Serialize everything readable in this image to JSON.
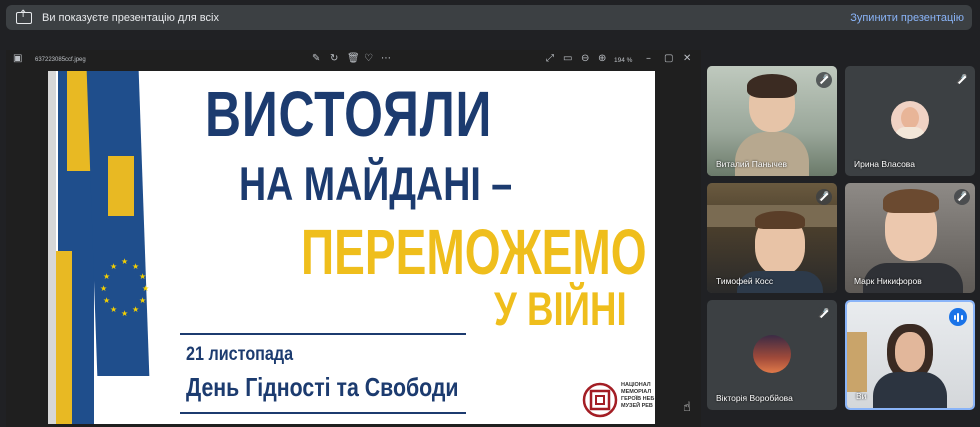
{
  "banner": {
    "text": "Ви показуєте презентацію для всіх",
    "stop_label": "Зупинити презентацію"
  },
  "viewer": {
    "filename": "637223085ccf.jpeg",
    "zoom": "194 %",
    "icons": [
      "image-icon",
      "expand-icon",
      "fit-screen-icon",
      "zoom-out-icon",
      "zoom-in-icon",
      "minimize-icon",
      "restore-icon",
      "close-icon",
      "edit-icon",
      "rotate-icon",
      "delete-icon",
      "favorite-icon",
      "more-icon"
    ]
  },
  "slide": {
    "line1": "ВИСТОЯЛИ",
    "line2": "НА МАЙДАНІ –",
    "line3": "ПЕРЕМОЖЕМО",
    "line4": "У ВІЙНІ",
    "date": "21 листопада",
    "day": "День Гідності та Свободи",
    "logo_text": [
      "НАЦІОНАЛ",
      "МЕМОРІАЛ",
      "ГЕРОЇВ НЕБ",
      "МУЗЕЙ РЕВ"
    ],
    "colors": {
      "blue": "#1c3b6f",
      "yellow": "#efbe1c"
    }
  },
  "participants": [
    {
      "name": "Виталий Панычев",
      "muted": true,
      "video": true
    },
    {
      "name": "Ирина Власова",
      "muted": true,
      "video": false
    },
    {
      "name": "Тимофей Косс",
      "muted": true,
      "video": true
    },
    {
      "name": "Марк Никифоров",
      "muted": true,
      "video": true
    },
    {
      "name": "Вікторія Воробйова",
      "muted": true,
      "video": false
    },
    {
      "name": "Ви",
      "muted": false,
      "video": true,
      "speaking": true
    }
  ],
  "colors": {
    "accent": "#8ab4f8",
    "speaking": "#1a73e8",
    "tile": "#3c4043"
  }
}
